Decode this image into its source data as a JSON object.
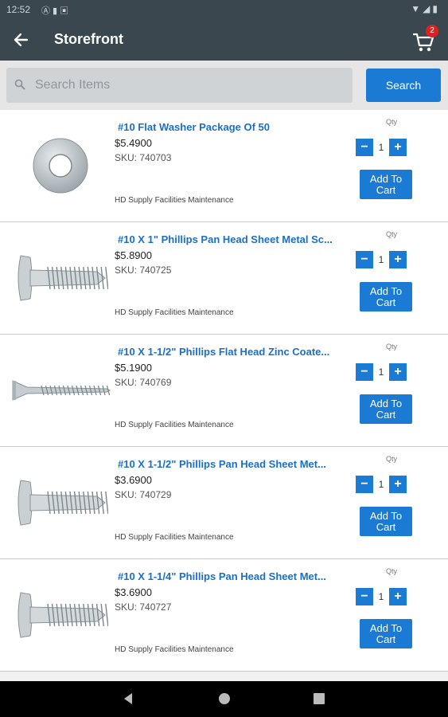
{
  "status_bar": {
    "time": "12:52",
    "icons": [
      "notification-a-icon",
      "notification-b-icon",
      "notification-c-icon"
    ]
  },
  "app_bar": {
    "title": "Storefront",
    "cart_count": "2"
  },
  "search": {
    "placeholder": "Search Items",
    "value": "",
    "button_label": "Search"
  },
  "qty_label": "Qty",
  "add_label_line1": "Add To",
  "add_label_line2": "Cart",
  "items": [
    {
      "name": "#10 Flat Washer Package Of 50",
      "price": "$5.4900",
      "sku": "SKU: 740703",
      "supplier": "HD Supply Facilities Maintenance",
      "qty": "1",
      "image": "washer"
    },
    {
      "name": "#10 X 1\" Phillips Pan Head Sheet Metal Sc...",
      "price": "$5.8900",
      "sku": "SKU: 740725",
      "supplier": "HD Supply Facilities Maintenance",
      "qty": "1",
      "image": "pan-screw"
    },
    {
      "name": "#10 X 1-1/2\" Phillips Flat Head Zinc Coate...",
      "price": "$5.1900",
      "sku": "SKU: 740769",
      "supplier": "HD Supply Facilities Maintenance",
      "qty": "1",
      "image": "flat-screw"
    },
    {
      "name": "#10 X 1-1/2\" Phillips Pan Head Sheet Met...",
      "price": "$3.6900",
      "sku": "SKU: 740729",
      "supplier": "HD Supply Facilities Maintenance",
      "qty": "1",
      "image": "pan-screw"
    },
    {
      "name": "#10 X 1-1/4\" Phillips Pan Head Sheet Met...",
      "price": "$3.6900",
      "sku": "SKU: 740727",
      "supplier": "HD Supply Facilities Maintenance",
      "qty": "1",
      "image": "pan-screw"
    }
  ],
  "colors": {
    "app_bar": "#3a474f",
    "accent": "#1a7ad4",
    "link": "#1a6fc9",
    "badge": "#e02020"
  }
}
